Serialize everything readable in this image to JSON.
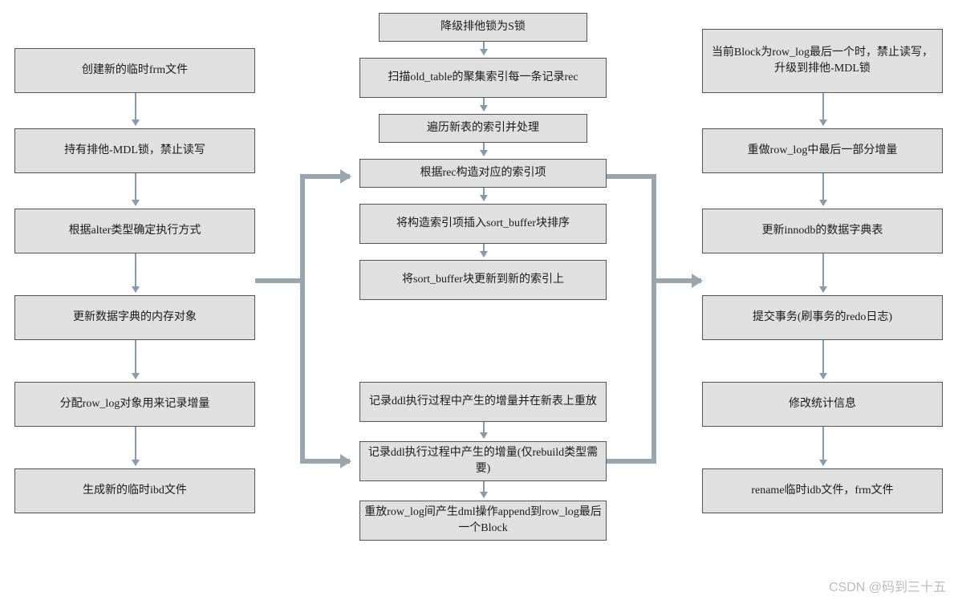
{
  "watermark": "CSDN @码到三十五",
  "columns": {
    "left": {
      "n1": "创建新的临时frm文件",
      "n2": "持有排他-MDL锁，禁止读写",
      "n3": "根据alter类型确定执行方式",
      "n4": "更新数据字典的内存对象",
      "n5": "分配row_log对象用来记录增量",
      "n6": "生成新的临时ibd文件"
    },
    "middleTop": {
      "n1": "降级排他锁为S锁",
      "n2": "扫描old_table的聚集索引每一条记录rec",
      "n3": "遍历新表的索引并处理",
      "n4": "根据rec构造对应的索引项",
      "n5": "将构造索引项插入sort_buffer块排序",
      "n6": "将sort_buffer块更新到新的索引上"
    },
    "middleBottom": {
      "n1": "记录ddl执行过程中产生的增量并在新表上重放",
      "n2": "记录ddl执行过程中产生的增量(仅rebuild类型需要)",
      "n3": "重放row_log间产生dml操作append到row_log最后一个Block"
    },
    "right": {
      "n1": "当前Block为row_log最后一个时，禁止读写，升级到排他-MDL锁",
      "n2": "重做row_log中最后一部分增量",
      "n3": "更新innodb的数据字典表",
      "n4": "提交事务(刷事务的redo日志)",
      "n5": "修改统计信息",
      "n6": "rename临时idb文件，frm文件"
    }
  }
}
